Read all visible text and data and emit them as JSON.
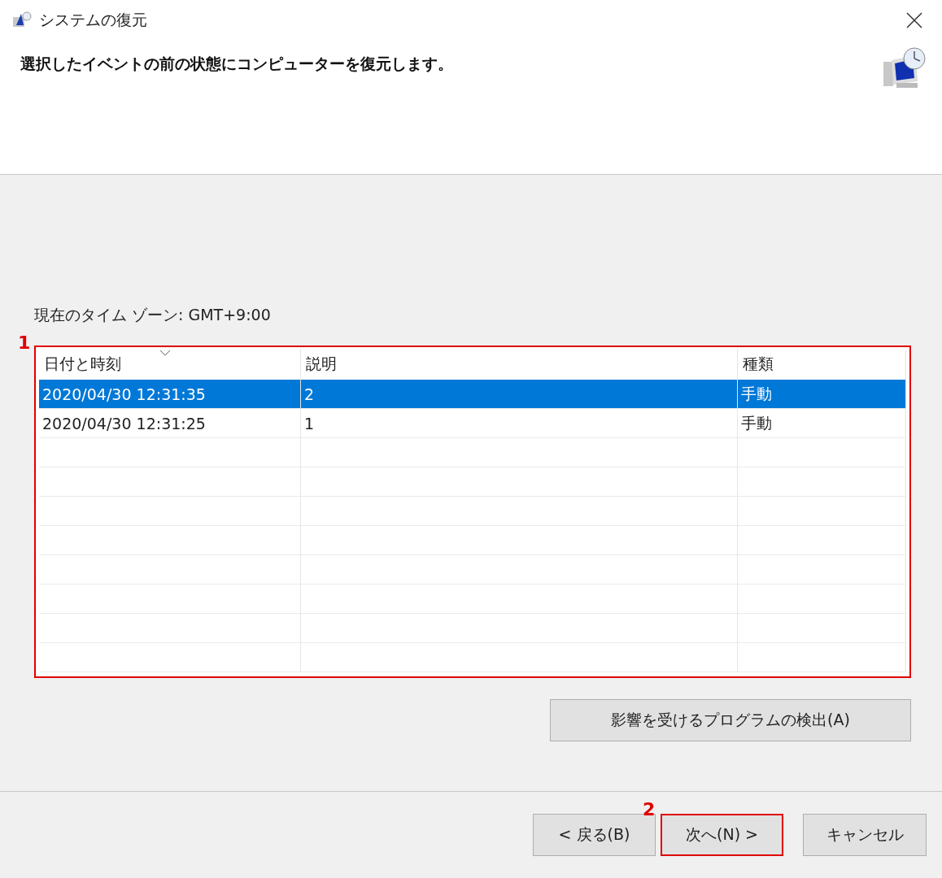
{
  "window": {
    "title": "システムの復元"
  },
  "heading": "選択したイベントの前の状態にコンピューターを復元します。",
  "timezone": "現在のタイム ゾーン: GMT+9:00",
  "table": {
    "annotation": "1",
    "highlighted": true,
    "columns": [
      {
        "label": "日付と時刻",
        "sorted": true
      },
      {
        "label": "説明",
        "sorted": false
      },
      {
        "label": "種類",
        "sorted": false
      }
    ],
    "rows": [
      {
        "cells": [
          "2020/04/30 12:31:35",
          "2",
          "手動"
        ],
        "selected": true
      },
      {
        "cells": [
          "2020/04/30 12:31:25",
          "1",
          "手動"
        ],
        "selected": false
      }
    ]
  },
  "detect_button": {
    "label": "影響を受けるプログラムの検出(A)"
  },
  "buttons": [
    {
      "label": "< 戻る(B)",
      "highlighted": false
    },
    {
      "label": "次へ(N) >",
      "highlighted": true,
      "annotation": "2"
    },
    {
      "label": "キャンセル",
      "highlighted": false
    }
  ]
}
